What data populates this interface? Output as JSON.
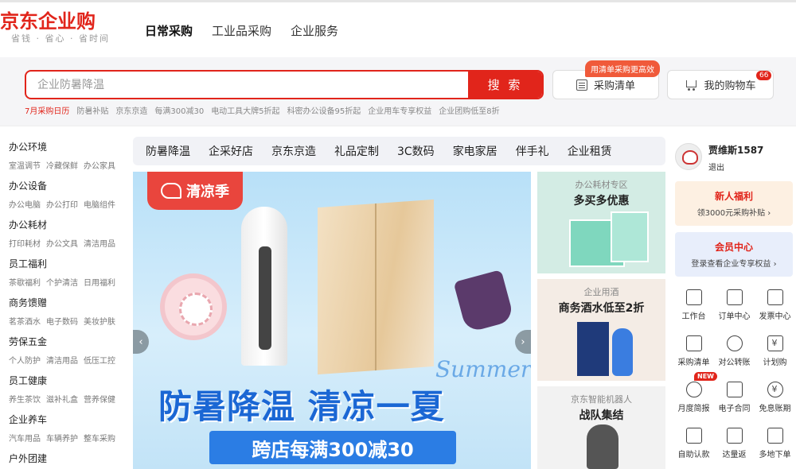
{
  "header": {
    "logo": "京东企业购",
    "logo_sub": "省钱 · 省心 · 省时间",
    "nav": [
      "日常采购",
      "工业品采购",
      "企业服务"
    ]
  },
  "search": {
    "placeholder": "企业防暑降温",
    "button": "搜 索",
    "hot_words": [
      "7月采购日历",
      "防暑补贴",
      "京东京造",
      "每满300减30",
      "电动工具大牌5折起",
      "科密办公设备95折起",
      "企业用车专享权益",
      "企业团购低至8折"
    ]
  },
  "purchase_list": {
    "label": "采购清单",
    "bubble": "用清单采购更高效"
  },
  "cart": {
    "label": "我的购物车",
    "count": "66"
  },
  "categories": [
    {
      "title": "办公环境",
      "subs": [
        "室温调节",
        "冷藏保鲜",
        "办公家具"
      ]
    },
    {
      "title": "办公设备",
      "subs": [
        "办公电脑",
        "办公打印",
        "电脑组件"
      ]
    },
    {
      "title": "办公耗材",
      "subs": [
        "打印耗材",
        "办公文具",
        "清洁用品"
      ]
    },
    {
      "title": "员工福利",
      "subs": [
        "茶歇福利",
        "个护清洁",
        "日用福利"
      ]
    },
    {
      "title": "商务馈赠",
      "subs": [
        "茗茶酒水",
        "电子数码",
        "美妆护肤"
      ]
    },
    {
      "title": "劳保五金",
      "subs": [
        "个人防护",
        "清洁用品",
        "低压工控"
      ]
    },
    {
      "title": "员工健康",
      "subs": [
        "养生茶饮",
        "滋补礼盒",
        "营养保健"
      ]
    },
    {
      "title": "企业养车",
      "subs": [
        "汽车用品",
        "车辆养护",
        "整车采购"
      ]
    },
    {
      "title": "户外团建",
      "subs": []
    }
  ],
  "tabs": [
    "防暑降温",
    "企采好店",
    "京东京造",
    "礼品定制",
    "3C数码",
    "家电家居",
    "伴手礼",
    "企业租赁"
  ],
  "banner": {
    "tag": "清凉季",
    "headline": "防暑降温 清凉一夏",
    "subline": "跨店每满300减30",
    "script_word": "Summer"
  },
  "promos": [
    {
      "title": "办公耗材专区",
      "main": "多买多优惠"
    },
    {
      "title": "企业用酒",
      "main": "商务酒水低至2折"
    },
    {
      "title": "京东智能机器人",
      "main": "战队集结"
    }
  ],
  "user": {
    "name": "贾维斯1587",
    "logout": "退出"
  },
  "cards": {
    "newbie": {
      "title": "新人福利",
      "sub": "领3000元采购补贴 ›"
    },
    "member": {
      "title": "会员中心",
      "sub": "登录查看企业专享权益 ›"
    }
  },
  "shortcuts": [
    {
      "label": "工作台",
      "icon": "monitor-icon"
    },
    {
      "label": "订单中心",
      "icon": "order-icon"
    },
    {
      "label": "发票中心",
      "icon": "invoice-icon"
    },
    {
      "label": "采购清单",
      "icon": "list-icon"
    },
    {
      "label": "对公转账",
      "icon": "transfer-icon"
    },
    {
      "label": "计划购",
      "icon": "plan-icon"
    },
    {
      "label": "月度简报",
      "icon": "report-icon",
      "badge": "NEW"
    },
    {
      "label": "电子合同",
      "icon": "contract-icon"
    },
    {
      "label": "免息账期",
      "icon": "credit-icon"
    },
    {
      "label": "自助认款",
      "icon": "card-icon"
    },
    {
      "label": "达量返",
      "icon": "rebate-icon"
    },
    {
      "label": "多地下单",
      "icon": "multi-address-icon"
    }
  ]
}
